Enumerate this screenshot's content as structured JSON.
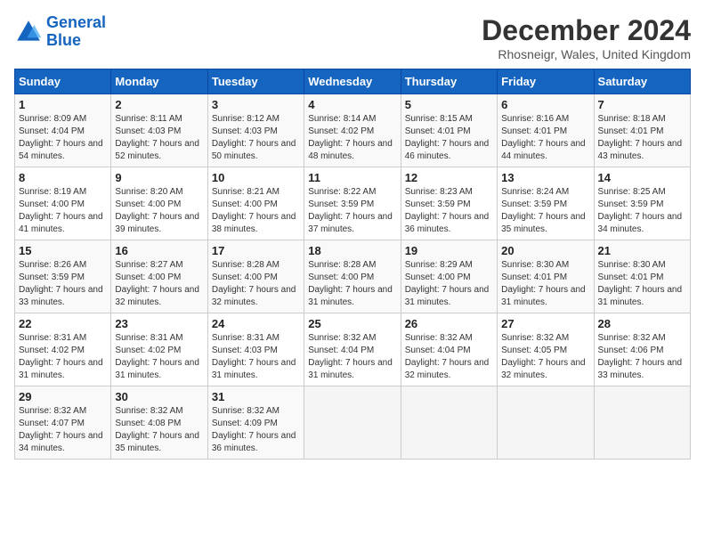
{
  "logo": {
    "line1": "General",
    "line2": "Blue"
  },
  "title": "December 2024",
  "subtitle": "Rhosneigr, Wales, United Kingdom",
  "headers": [
    "Sunday",
    "Monday",
    "Tuesday",
    "Wednesday",
    "Thursday",
    "Friday",
    "Saturday"
  ],
  "weeks": [
    [
      {
        "day": "1",
        "sunrise": "8:09 AM",
        "sunset": "4:04 PM",
        "daylight": "7 hours and 54 minutes."
      },
      {
        "day": "2",
        "sunrise": "8:11 AM",
        "sunset": "4:03 PM",
        "daylight": "7 hours and 52 minutes."
      },
      {
        "day": "3",
        "sunrise": "8:12 AM",
        "sunset": "4:03 PM",
        "daylight": "7 hours and 50 minutes."
      },
      {
        "day": "4",
        "sunrise": "8:14 AM",
        "sunset": "4:02 PM",
        "daylight": "7 hours and 48 minutes."
      },
      {
        "day": "5",
        "sunrise": "8:15 AM",
        "sunset": "4:01 PM",
        "daylight": "7 hours and 46 minutes."
      },
      {
        "day": "6",
        "sunrise": "8:16 AM",
        "sunset": "4:01 PM",
        "daylight": "7 hours and 44 minutes."
      },
      {
        "day": "7",
        "sunrise": "8:18 AM",
        "sunset": "4:01 PM",
        "daylight": "7 hours and 43 minutes."
      }
    ],
    [
      {
        "day": "8",
        "sunrise": "8:19 AM",
        "sunset": "4:00 PM",
        "daylight": "7 hours and 41 minutes."
      },
      {
        "day": "9",
        "sunrise": "8:20 AM",
        "sunset": "4:00 PM",
        "daylight": "7 hours and 39 minutes."
      },
      {
        "day": "10",
        "sunrise": "8:21 AM",
        "sunset": "4:00 PM",
        "daylight": "7 hours and 38 minutes."
      },
      {
        "day": "11",
        "sunrise": "8:22 AM",
        "sunset": "3:59 PM",
        "daylight": "7 hours and 37 minutes."
      },
      {
        "day": "12",
        "sunrise": "8:23 AM",
        "sunset": "3:59 PM",
        "daylight": "7 hours and 36 minutes."
      },
      {
        "day": "13",
        "sunrise": "8:24 AM",
        "sunset": "3:59 PM",
        "daylight": "7 hours and 35 minutes."
      },
      {
        "day": "14",
        "sunrise": "8:25 AM",
        "sunset": "3:59 PM",
        "daylight": "7 hours and 34 minutes."
      }
    ],
    [
      {
        "day": "15",
        "sunrise": "8:26 AM",
        "sunset": "3:59 PM",
        "daylight": "7 hours and 33 minutes."
      },
      {
        "day": "16",
        "sunrise": "8:27 AM",
        "sunset": "4:00 PM",
        "daylight": "7 hours and 32 minutes."
      },
      {
        "day": "17",
        "sunrise": "8:28 AM",
        "sunset": "4:00 PM",
        "daylight": "7 hours and 32 minutes."
      },
      {
        "day": "18",
        "sunrise": "8:28 AM",
        "sunset": "4:00 PM",
        "daylight": "7 hours and 31 minutes."
      },
      {
        "day": "19",
        "sunrise": "8:29 AM",
        "sunset": "4:00 PM",
        "daylight": "7 hours and 31 minutes."
      },
      {
        "day": "20",
        "sunrise": "8:30 AM",
        "sunset": "4:01 PM",
        "daylight": "7 hours and 31 minutes."
      },
      {
        "day": "21",
        "sunrise": "8:30 AM",
        "sunset": "4:01 PM",
        "daylight": "7 hours and 31 minutes."
      }
    ],
    [
      {
        "day": "22",
        "sunrise": "8:31 AM",
        "sunset": "4:02 PM",
        "daylight": "7 hours and 31 minutes."
      },
      {
        "day": "23",
        "sunrise": "8:31 AM",
        "sunset": "4:02 PM",
        "daylight": "7 hours and 31 minutes."
      },
      {
        "day": "24",
        "sunrise": "8:31 AM",
        "sunset": "4:03 PM",
        "daylight": "7 hours and 31 minutes."
      },
      {
        "day": "25",
        "sunrise": "8:32 AM",
        "sunset": "4:04 PM",
        "daylight": "7 hours and 31 minutes."
      },
      {
        "day": "26",
        "sunrise": "8:32 AM",
        "sunset": "4:04 PM",
        "daylight": "7 hours and 32 minutes."
      },
      {
        "day": "27",
        "sunrise": "8:32 AM",
        "sunset": "4:05 PM",
        "daylight": "7 hours and 32 minutes."
      },
      {
        "day": "28",
        "sunrise": "8:32 AM",
        "sunset": "4:06 PM",
        "daylight": "7 hours and 33 minutes."
      }
    ],
    [
      {
        "day": "29",
        "sunrise": "8:32 AM",
        "sunset": "4:07 PM",
        "daylight": "7 hours and 34 minutes."
      },
      {
        "day": "30",
        "sunrise": "8:32 AM",
        "sunset": "4:08 PM",
        "daylight": "7 hours and 35 minutes."
      },
      {
        "day": "31",
        "sunrise": "8:32 AM",
        "sunset": "4:09 PM",
        "daylight": "7 hours and 36 minutes."
      },
      null,
      null,
      null,
      null
    ]
  ]
}
